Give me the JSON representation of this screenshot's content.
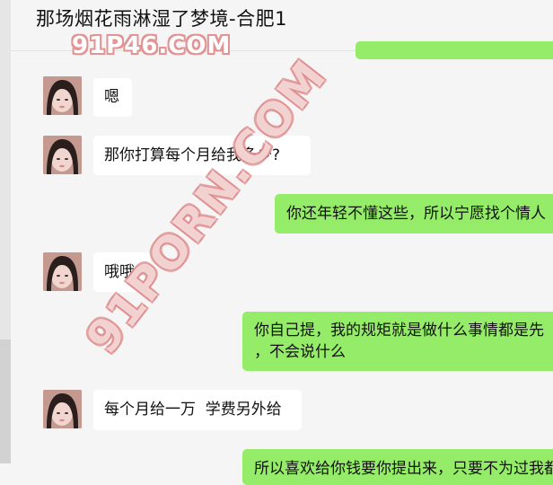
{
  "chat": {
    "title": "那场烟花雨淋湿了梦境-合肥1"
  },
  "watermarks": {
    "top": "91P46.COM",
    "diagonal": "91PORN.COM"
  },
  "messages": [
    {
      "side": "in",
      "text": "嗯"
    },
    {
      "side": "in",
      "text": "那你打算每个月给我多少?"
    },
    {
      "side": "out",
      "text": "你还年轻不懂这些，所以宁愿找个情人"
    },
    {
      "side": "in",
      "text": "哦哦"
    },
    {
      "side": "out",
      "line1": "你自己提，我的规矩就是做什么事情都是先",
      "line2": "，不会说什么"
    },
    {
      "side": "in",
      "text": "每个月给一万  学费另外给"
    },
    {
      "side": "out",
      "text": "所以喜欢给你钱要你提出来，只要不为过我都给你，就像你每个月的生活费"
    }
  ]
}
